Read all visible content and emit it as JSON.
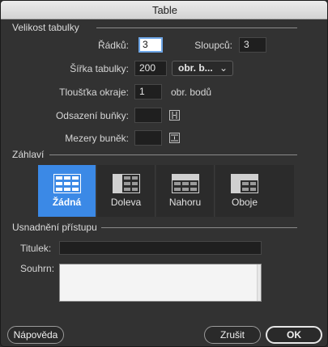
{
  "window": {
    "title": "Table"
  },
  "table_size": {
    "section_label": "Velikost tabulky",
    "rows_label": "Řádků:",
    "rows_value": "3",
    "cols_label": "Sloupců:",
    "cols_value": "3",
    "width_label": "Šířka tabulky:",
    "width_value": "200",
    "width_unit": "obr. b...",
    "border_label": "Tloušťka okraje:",
    "border_value": "1",
    "border_unit": "obr. bodů",
    "padding_label": "Odsazení buňky:",
    "padding_value": "",
    "spacing_label": "Mezery buněk:",
    "spacing_value": ""
  },
  "header": {
    "section_label": "Záhlaví",
    "options": [
      {
        "label": "Žádná",
        "selected": true
      },
      {
        "label": "Doleva",
        "selected": false
      },
      {
        "label": "Nahoru",
        "selected": false
      },
      {
        "label": "Oboje",
        "selected": false
      }
    ]
  },
  "accessibility": {
    "section_label": "Usnadnění přístupu",
    "caption_label": "Titulek:",
    "caption_value": "",
    "summary_label": "Souhrn:",
    "summary_value": ""
  },
  "buttons": {
    "help": "Nápověda",
    "cancel": "Zrušit",
    "ok": "OK"
  },
  "colors": {
    "selected_accent": "#3b89e6",
    "dialog_bg": "#323232"
  },
  "icons": {
    "padding": "cell-padding-icon",
    "spacing": "cell-spacing-icon",
    "dropdown": "chevron-down-icon"
  }
}
